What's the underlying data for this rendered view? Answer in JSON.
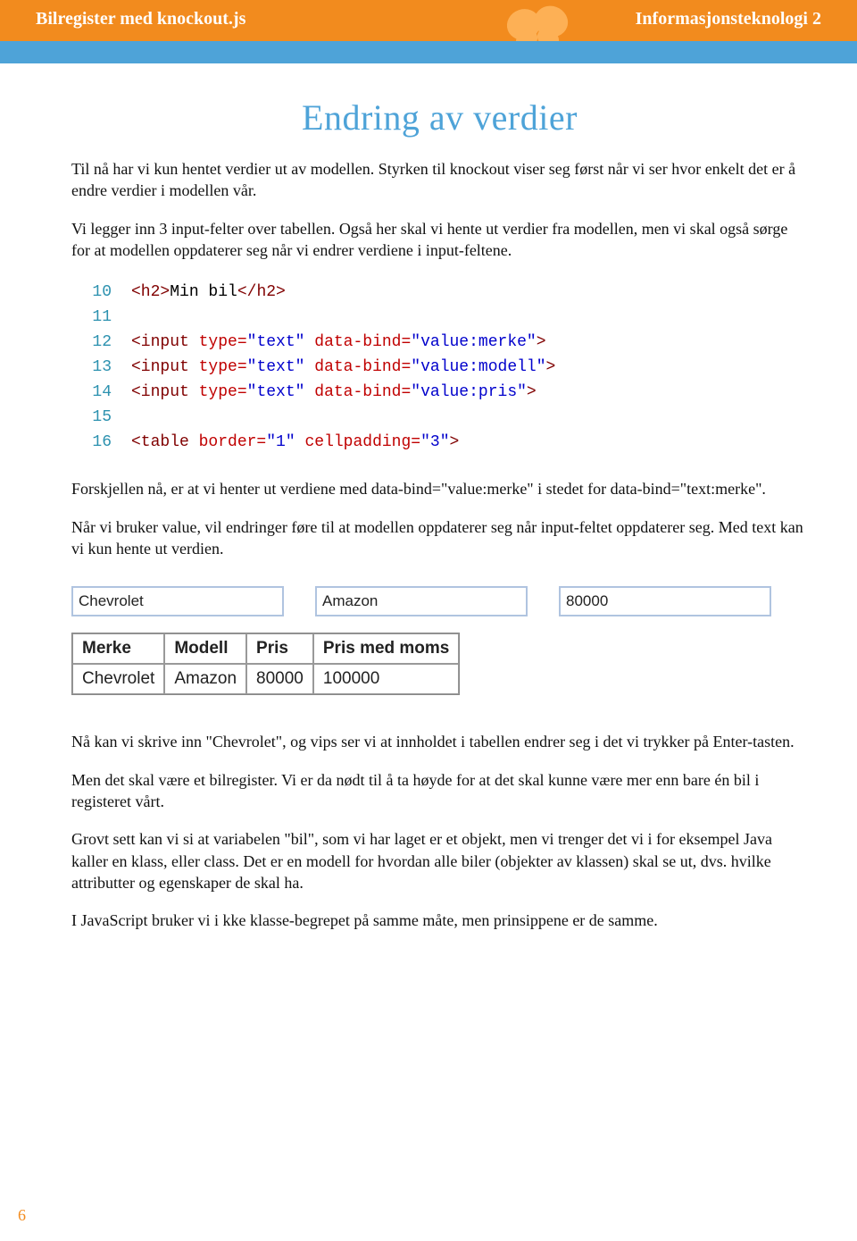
{
  "header": {
    "left": "Bilregister med knockout.js",
    "right": "Informasjonsteknologi 2"
  },
  "heading": "Endring av verdier",
  "para1": "Til nå har vi kun hentet verdier ut av modellen. Styrken til knockout viser seg først når vi ser hvor enkelt det er å endre verdier i modellen vår.",
  "para2": "Vi legger inn 3 input-felter over tabellen. Også her skal vi hente ut verdier fra modellen, men vi skal også sørge for at modellen oppdaterer seg når vi endrer verdiene i input-feltene.",
  "code": {
    "lines": [
      {
        "n": "10",
        "html": "<span class='tag'>&lt;h2&gt;</span><span class='txt'>Min bil</span><span class='tag'>&lt;/h2&gt;</span>"
      },
      {
        "n": "11",
        "html": ""
      },
      {
        "n": "12",
        "html": "<span class='tag'>&lt;input</span> <span class='attr'>type=</span><span class='strval'>\"text\"</span> <span class='attr'>data-bind=</span><span class='strval'>\"value:merke\"</span><span class='tag'>&gt;</span>"
      },
      {
        "n": "13",
        "html": "<span class='tag'>&lt;input</span> <span class='attr'>type=</span><span class='strval'>\"text\"</span> <span class='attr'>data-bind=</span><span class='strval'>\"value:modell\"</span><span class='tag'>&gt;</span>"
      },
      {
        "n": "14",
        "html": "<span class='tag'>&lt;input</span> <span class='attr'>type=</span><span class='strval'>\"text\"</span> <span class='attr'>data-bind=</span><span class='strval'>\"value:pris\"</span><span class='tag'>&gt;</span>"
      },
      {
        "n": "15",
        "html": ""
      },
      {
        "n": "16",
        "html": "<span class='tag'>&lt;table</span> <span class='attr'>border=</span><span class='strval'>\"1\"</span> <span class='attr'>cellpadding=</span><span class='strval'>\"3\"</span><span class='tag'>&gt;</span>"
      }
    ]
  },
  "para3": "Forskjellen nå, er at vi henter ut verdiene med data-bind=\"value:merke\" i stedet for data-bind=\"text:merke\".",
  "para4": "Når vi bruker value, vil endringer føre til at modellen oppdaterer seg når input-feltet oppdaterer seg. Med text kan vi kun hente ut verdien.",
  "inputs": {
    "merke": "Chevrolet",
    "modell": "Amazon",
    "pris": "80000"
  },
  "table": {
    "headers": [
      "Merke",
      "Modell",
      "Pris",
      "Pris med moms"
    ],
    "row": [
      "Chevrolet",
      "Amazon",
      "80000",
      "100000"
    ]
  },
  "para5": "Nå kan vi skrive inn \"Chevrolet\", og vips ser vi at innholdet i tabellen endrer seg i det vi trykker på Enter-tasten.",
  "para6": "Men det skal være et bilregister. Vi er da nødt til å ta høyde for at det skal kunne være mer enn bare én bil i registeret vårt.",
  "para7": "Grovt sett kan vi si at variabelen \"bil\", som vi har laget er et objekt, men vi trenger det vi i for eksempel Java kaller en klass, eller class. Det er en modell for hvordan alle biler (objekter av klassen) skal se ut, dvs. hvilke attributter og egenskaper de skal ha.",
  "para8": "I JavaScript bruker vi i kke klasse-begrepet på samme måte, men prinsippene er de samme.",
  "pagenum": "6"
}
